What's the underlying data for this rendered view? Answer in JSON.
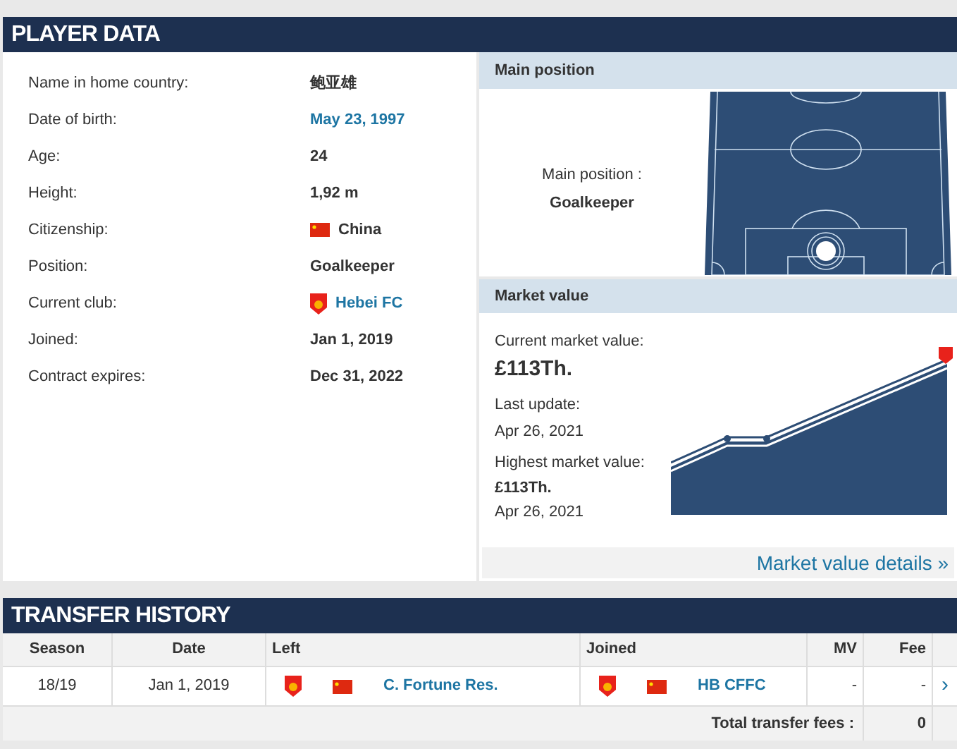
{
  "player_data": {
    "title": "PLAYER DATA",
    "rows": [
      {
        "label": "Name in home country:",
        "value": "鲍亚雄",
        "kind": "text"
      },
      {
        "label": "Date of birth:",
        "value": "May 23, 1997",
        "kind": "link"
      },
      {
        "label": "Age:",
        "value": "24",
        "kind": "text"
      },
      {
        "label": "Height:",
        "value": "1,92 m",
        "kind": "text"
      },
      {
        "label": "Citizenship:",
        "value": "China",
        "kind": "flag"
      },
      {
        "label": "Position:",
        "value": "Goalkeeper",
        "kind": "text"
      },
      {
        "label": "Current club:",
        "value": "Hebei FC",
        "kind": "club"
      },
      {
        "label": "Joined:",
        "value": "Jan 1, 2019",
        "kind": "text"
      },
      {
        "label": "Contract expires:",
        "value": "Dec 31, 2022",
        "kind": "text"
      }
    ]
  },
  "main_position": {
    "title": "Main position",
    "label": "Main position :",
    "value": "Goalkeeper"
  },
  "market_value": {
    "title": "Market value",
    "current_label": "Current market value:",
    "current_value": "£113Th.",
    "update_label": "Last update:",
    "update_date": "Apr 26, 2021",
    "highest_label": "Highest market value:",
    "highest_value": "£113Th.",
    "highest_date": "Apr 26, 2021",
    "details_link": "Market value details »"
  },
  "transfer_history": {
    "title": "TRANSFER HISTORY",
    "columns": [
      "Season",
      "Date",
      "Left",
      "Joined",
      "MV",
      "Fee"
    ],
    "rows": [
      {
        "season": "18/19",
        "date": "Jan 1, 2019",
        "left": "C. Fortune Res.",
        "joined": "HB CFFC",
        "mv": "-",
        "fee": "-",
        "arrow": "›"
      }
    ],
    "total_label": "Total transfer fees :",
    "total_value": "0"
  }
}
